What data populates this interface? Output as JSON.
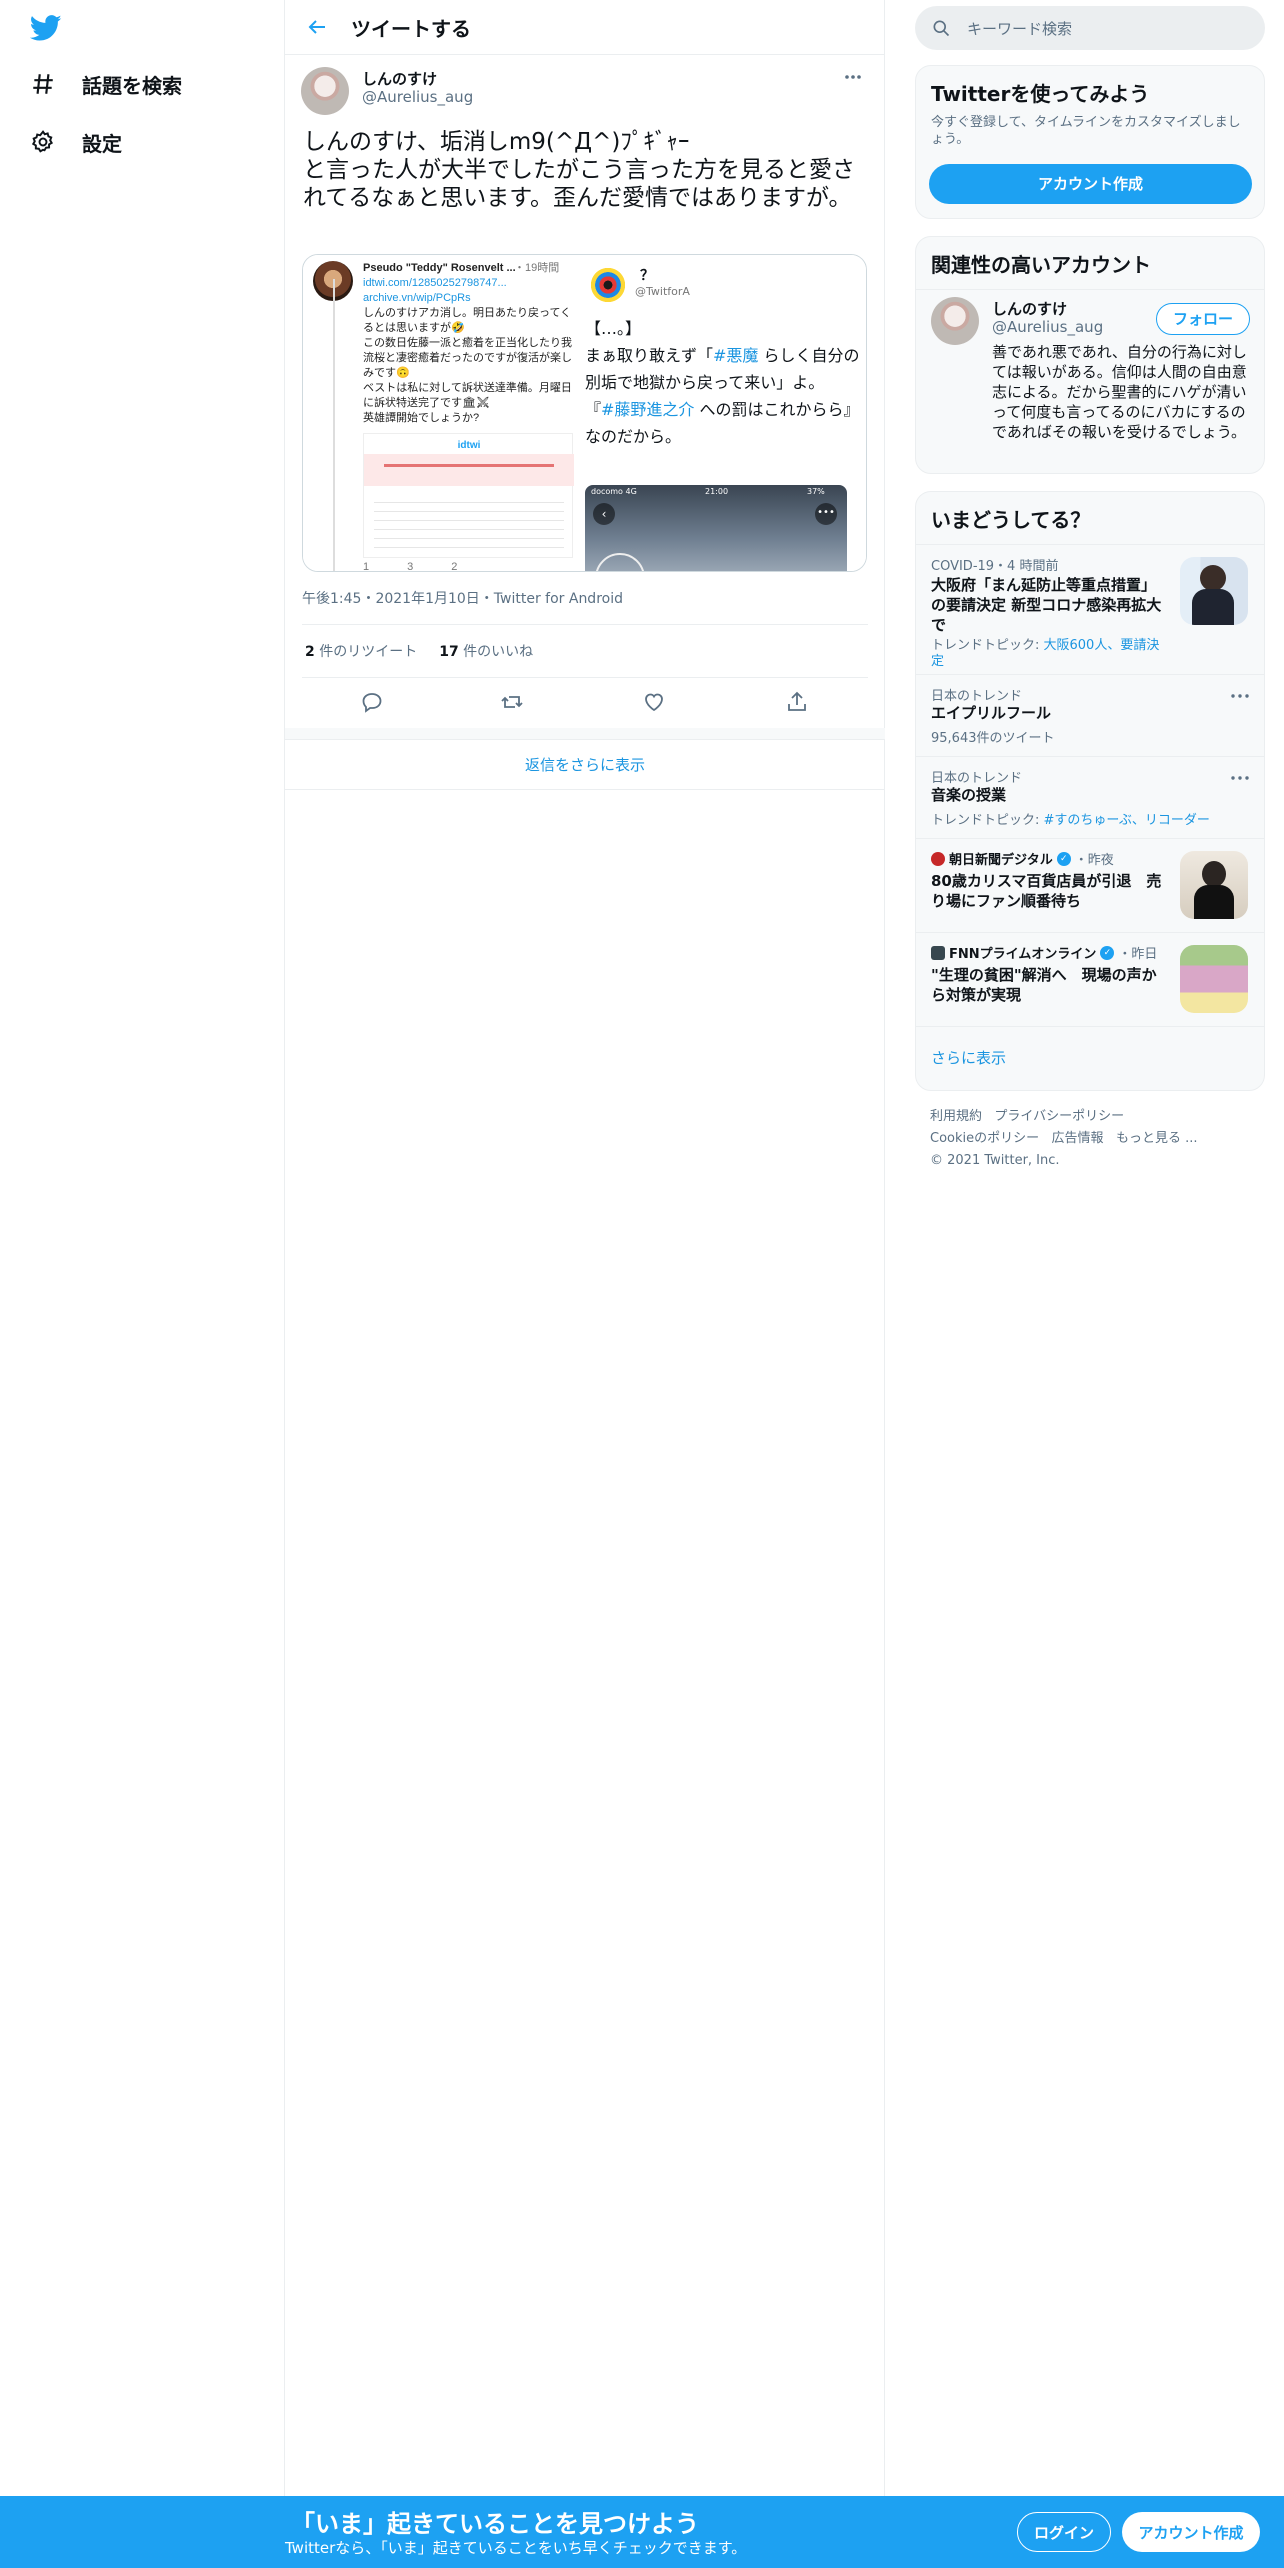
{
  "nav": {
    "items": [
      {
        "label": "話題を検索",
        "icon": "hashtag-icon"
      },
      {
        "label": "設定",
        "icon": "gear-icon"
      }
    ]
  },
  "header": {
    "title": "ツイートする"
  },
  "tweet": {
    "name": "しんのすけ",
    "handle": "@Aurelius_aug",
    "text": "しんのすけ、垢消しm9(^Д^)ﾌﾟｷﾞｬｰ\nと言った人が大半でしたがこう言った方を見ると愛されてるなぁと思います。歪んだ愛情ではありますが。",
    "meta": "午後1:45・2021年1月10日・Twitter for Android",
    "retweets_count": "2",
    "retweets_label": "件のリツイート",
    "likes_count": "17",
    "likes_label": "件のいいね",
    "show_more_replies": "返信をさらに表示"
  },
  "media": {
    "left": {
      "name": "Pseudo \"Teddy\" Rosenvelt ...",
      "time": "・19時間",
      "link1": "idtwi.com/12850252798747...",
      "link2": "archive.vn/wip/PCpRs",
      "body": "しんのすけアカ消し。明日あたり戻ってくるとは思いますが🤣\nこの数日佐藤一派と癒着を正当化したり我流桜と凄密癒着だったのですが復活が楽しみです🙃\nベストは私に対して訴状送達準備。月曜日に訴状特送完了です🏛⚔\n英雄譚開始でしょうか?",
      "banner": "idtwi",
      "counts": [
        "1",
        "3",
        "2"
      ]
    },
    "right": {
      "name": "？",
      "handle": "@TwitforA",
      "line1": "【…。】",
      "line2a": "まぁ取り敢えず「",
      "tag1": "#悪魔",
      "line2b": " らしく自分の別垢で地獄から戻って来い」よ。",
      "line3a": "『",
      "tag2": "#藤野進之介",
      "line3b": " への罰はこれからら』なのだから。",
      "phone_carrier": "docomo 4G",
      "phone_time": "21:00",
      "phone_battery": "37%"
    }
  },
  "search": {
    "placeholder": "キーワード検索"
  },
  "signup_card": {
    "title": "Twitterを使ってみよう",
    "desc": "今すぐ登録して、タイムラインをカスタマイズしましょう。",
    "button": "アカウント作成"
  },
  "related": {
    "title": "関連性の高いアカウント",
    "name": "しんのすけ",
    "handle": "@Aurelius_aug",
    "follow": "フォロー",
    "bio": "善であれ悪であれ、自分の行為に対しては報いがある。信仰は人間の自由意志による。だから聖書的にハゲが清いって何度も言ってるのにバカにするのであればその報いを受けるでしょう。"
  },
  "trends": {
    "title": "いまどうしてる？",
    "items": [
      {
        "context": "COVID-19・4 時間前",
        "title": "大阪府「まん延防止等重点措置」の要請決定 新型コロナ感染再拡大で",
        "sub_label": "トレンドトピック: ",
        "sub_links": "大阪600人、要請決定"
      },
      {
        "context": "日本のトレンド",
        "title": "エイプリルフール",
        "count": "95,643件のツイート"
      },
      {
        "context": "日本のトレンド",
        "title": "音楽の授業",
        "sub_label": "トレンドトピック: ",
        "sub_links": "#すのちゅーぶ、リコーダー"
      },
      {
        "source": "朝日新聞デジタル",
        "time": "・昨夜",
        "title": "80歳カリスマ百貨店員が引退　売り場にファン順番待ち"
      },
      {
        "source": "FNNプライムオンライン",
        "time": "・昨日",
        "title": "\"生理の貧困\"解消へ　現場の声から対策が実現"
      }
    ],
    "show_more": "さらに表示"
  },
  "footer": {
    "links1": [
      "利用規約",
      "プライバシーポリシー"
    ],
    "links2": [
      "Cookieのポリシー",
      "広告情報",
      "もっと見る ..."
    ],
    "copyright": "© 2021 Twitter, Inc."
  },
  "bottom_bar": {
    "title": "「いま」起きていることを見つけよう",
    "subtitle": "Twitterなら、「いま」起きていることをいち早くチェックできます。",
    "login": "ログイン",
    "signup": "アカウント作成"
  },
  "colors": {
    "accent": "#1da1f2",
    "link": "#1b95e0",
    "border": "#ebeef0"
  }
}
